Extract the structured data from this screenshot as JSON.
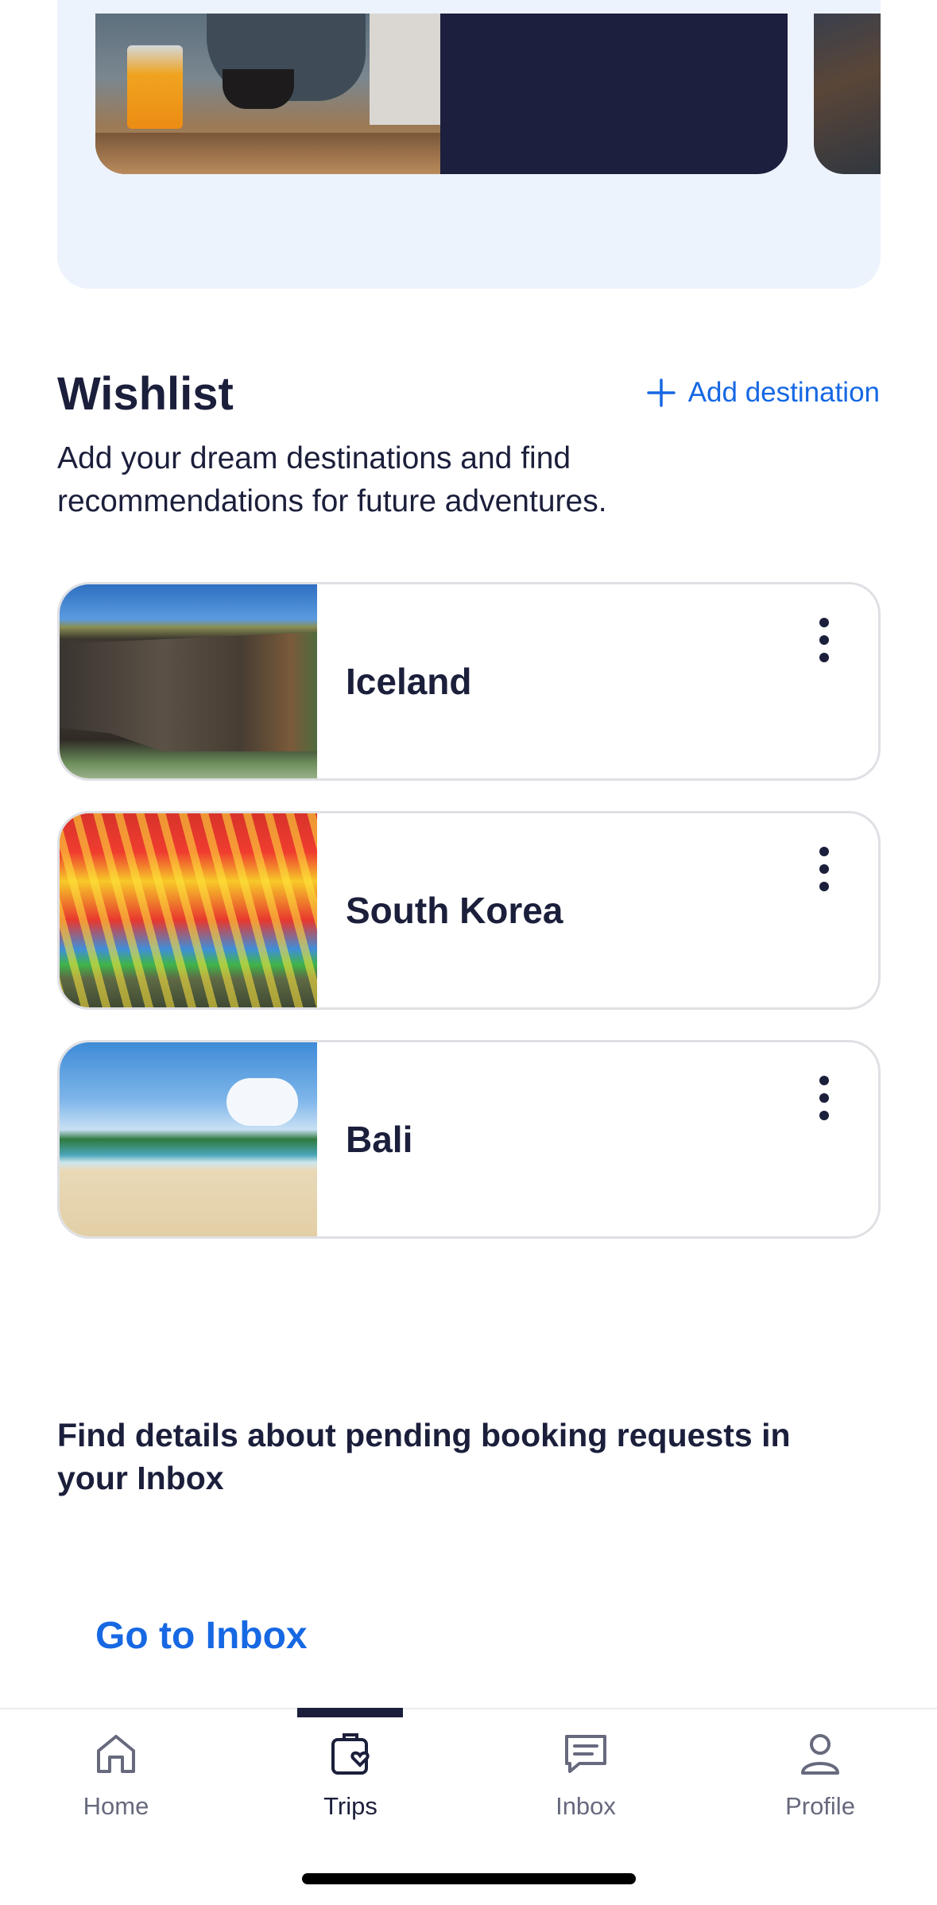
{
  "wishlist": {
    "title": "Wishlist",
    "add_label": "Add destination",
    "description": "Add your dream destinations and find recommendations for future adventures.",
    "items": [
      {
        "name": "Iceland"
      },
      {
        "name": "South Korea"
      },
      {
        "name": "Bali"
      }
    ]
  },
  "inbox_notice": {
    "text": "Find details about pending booking requests in your Inbox",
    "link_label": "Go to Inbox"
  },
  "tabbar": {
    "active": "Trips",
    "tabs": [
      {
        "label": "Home",
        "icon": "home-icon"
      },
      {
        "label": "Trips",
        "icon": "suitcase-heart-icon"
      },
      {
        "label": "Inbox",
        "icon": "chat-icon"
      },
      {
        "label": "Profile",
        "icon": "person-icon"
      }
    ]
  },
  "colors": {
    "accent": "#1668e3",
    "ink": "#1b1f3b",
    "promo_bg": "#edf3fd"
  }
}
